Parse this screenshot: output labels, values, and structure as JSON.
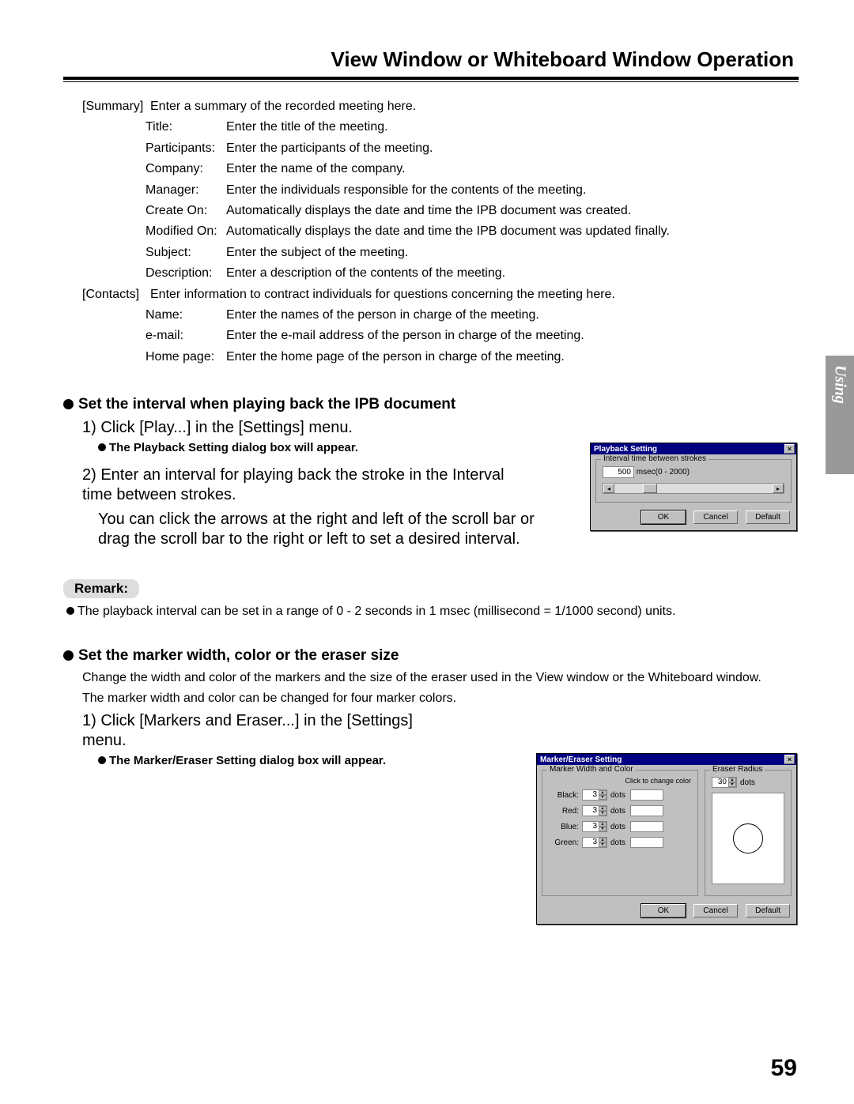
{
  "header": {
    "title": "View Window or Whiteboard Window Operation"
  },
  "sidetab": {
    "label": "Using"
  },
  "page_number": "59",
  "summary": {
    "category": "[Summary]",
    "desc": "Enter a summary of the recorded meeting here.",
    "rows": [
      {
        "k": "Title:",
        "v": "Enter the title of the meeting."
      },
      {
        "k": "Participants:",
        "v": "Enter the participants of the meeting."
      },
      {
        "k": "Company:",
        "v": "Enter the name of the company."
      },
      {
        "k": "Manager:",
        "v": "Enter the individuals responsible for the contents of the meeting."
      },
      {
        "k": "Create On:",
        "v": "Automatically displays the date and time the IPB document was created."
      },
      {
        "k": "Modified On:",
        "v": "Automatically displays the date and time the IPB document was updated finally."
      },
      {
        "k": "Subject:",
        "v": "Enter the subject of the meeting."
      },
      {
        "k": "Description:",
        "v": "Enter a description of the contents of the meeting."
      }
    ]
  },
  "contacts": {
    "category": "[Contacts]",
    "desc": "Enter information to contract individuals for questions concerning the meeting here.",
    "rows": [
      {
        "k": "Name:",
        "v": "Enter the names of the person in charge of the meeting."
      },
      {
        "k": "e-mail:",
        "v": "Enter the e-mail address of the person in charge of the meeting."
      },
      {
        "k": "Home page:",
        "v": "Enter the home page of the person in charge of the meeting."
      }
    ]
  },
  "section_interval": {
    "title": "Set the interval when playing back the IPB document",
    "step1": "1) Click [Play...] in the [Settings] menu.",
    "note1": "The Playback Setting dialog box will appear.",
    "step2_a": "2) Enter an interval for playing back the stroke in the Interval time between strokes.",
    "step2_b": "You can click the arrows at the right and left of the scroll bar or drag the scroll bar to the right or left to set a desired interval."
  },
  "remark": {
    "label": "Remark:",
    "text": "The playback interval can be set in a range of 0 - 2 seconds in 1 msec (millisecond = 1/1000 second) units."
  },
  "section_marker": {
    "title": "Set the marker width, color or the eraser size",
    "desc_a": "Change the width and color of the markers and the size of the eraser used in the View window or the Whiteboard window.",
    "desc_b": "The marker width and color can be changed for four marker colors.",
    "step1": "1) Click [Markers and Eraser...] in the [Settings] menu.",
    "note1": "The Marker/Eraser Setting dialog box will appear."
  },
  "dlg_playback": {
    "title": "Playback Setting",
    "group": "Interval time between strokes",
    "value": "500",
    "unit": "msec(0 - 2000)",
    "ok": "OK",
    "cancel": "Cancel",
    "default": "Default"
  },
  "dlg_marker": {
    "title": "Marker/Eraser Setting",
    "group_mw": "Marker Width and Color",
    "hint": "Click to change color",
    "group_er": "Eraser Radius",
    "rows": [
      {
        "label": "Black:",
        "val": "3",
        "unit": "dots"
      },
      {
        "label": "Red:",
        "val": "3",
        "unit": "dots"
      },
      {
        "label": "Blue:",
        "val": "3",
        "unit": "dots"
      },
      {
        "label": "Green:",
        "val": "3",
        "unit": "dots"
      }
    ],
    "er_val": "30",
    "er_unit": "dots",
    "ok": "OK",
    "cancel": "Cancel",
    "default": "Default"
  }
}
